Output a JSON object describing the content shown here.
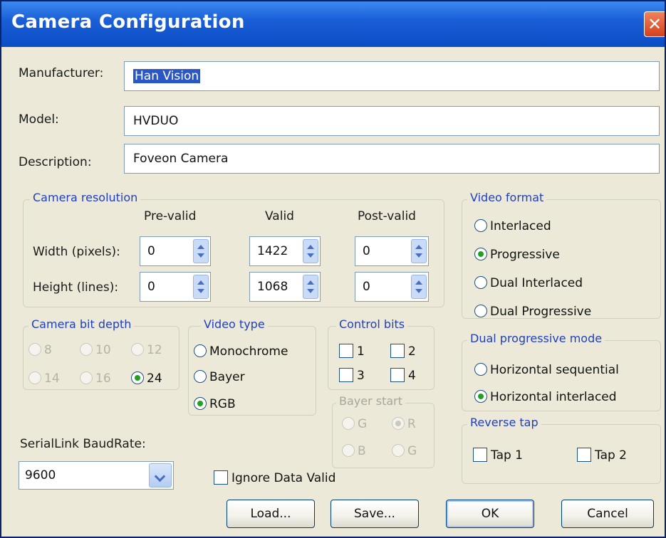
{
  "window": {
    "title": "Camera Configuration",
    "close_glyph": "✕"
  },
  "fields": {
    "manufacturer": {
      "label": "Manufacturer:",
      "value": "Han Vision"
    },
    "model": {
      "label": "Model:",
      "value": "HVDUO"
    },
    "description": {
      "label": "Description:",
      "value": "Foveon Camera"
    }
  },
  "resolution": {
    "title": "Camera resolution",
    "col_pre": "Pre-valid",
    "col_valid": "Valid",
    "col_post": "Post-valid",
    "width_label": "Width (pixels):",
    "height_label": "Height (lines):",
    "width": {
      "pre": "0",
      "valid": "1422",
      "post": "0"
    },
    "height": {
      "pre": "0",
      "valid": "1068",
      "post": "0"
    }
  },
  "video_format": {
    "title": "Video format",
    "options": [
      "Interlaced",
      "Progressive",
      "Dual Interlaced",
      "Dual Progressive"
    ],
    "selected": "Progressive"
  },
  "bit_depth": {
    "title": "Camera bit depth",
    "options": [
      "8",
      "10",
      "12",
      "14",
      "16",
      "24"
    ],
    "selected": "24"
  },
  "video_type": {
    "title": "Video type",
    "options": [
      "Monochrome",
      "Bayer",
      "RGB"
    ],
    "selected": "RGB"
  },
  "control_bits": {
    "title": "Control bits",
    "options": [
      "1",
      "2",
      "3",
      "4"
    ]
  },
  "bayer_start": {
    "title": "Bayer start",
    "options": [
      "G",
      "R",
      "B",
      "G"
    ],
    "selected": "R"
  },
  "dual_progressive": {
    "title": "Dual progressive mode",
    "options": [
      "Horizontal sequential",
      "Horizontal interlaced"
    ],
    "selected": "Horizontal interlaced"
  },
  "reverse_tap": {
    "title": "Reverse tap",
    "options": [
      "Tap 1",
      "Tap 2"
    ]
  },
  "serial": {
    "label": "SerialLink BaudRate:",
    "value": "9600"
  },
  "ignore_data_valid": {
    "label": "Ignore Data Valid"
  },
  "buttons": {
    "load": "Load...",
    "save": "Save...",
    "ok": "OK",
    "cancel": "Cancel"
  },
  "colors": {
    "titlebar": "#1b5fd8",
    "group_title": "#1f3fbf",
    "selection": "#2a57c3"
  }
}
